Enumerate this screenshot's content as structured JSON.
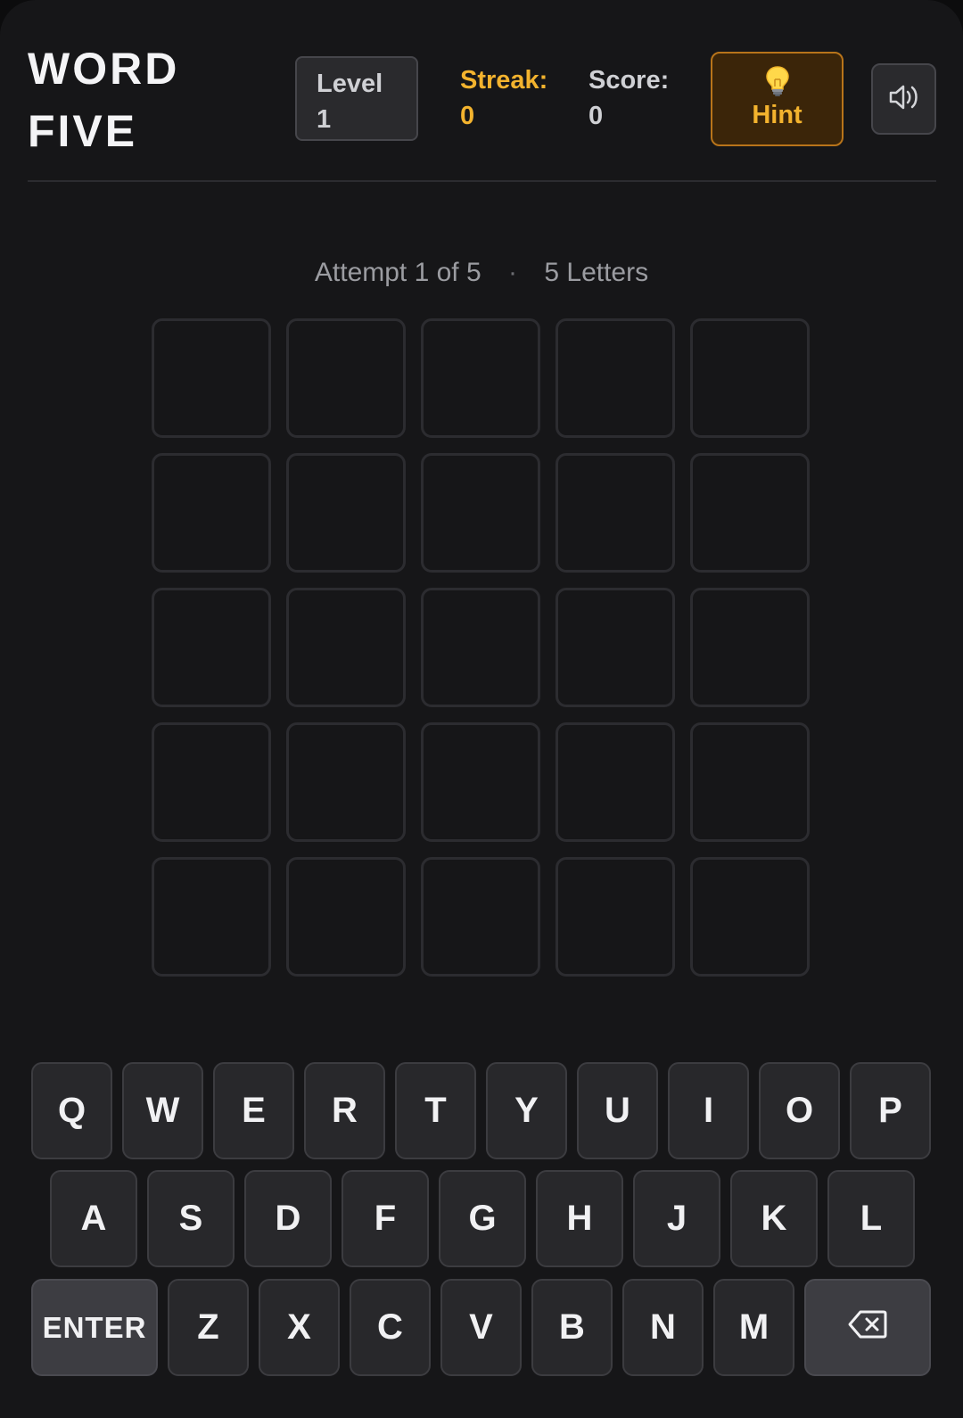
{
  "header": {
    "title_line1": "WORD",
    "title_line2": "FIVE",
    "level_label": "Level",
    "level_value": "1",
    "streak_label": "Streak:",
    "streak_value": "0",
    "score_label": "Score:",
    "score_value": "0",
    "hint_label": "Hint",
    "hint_icon": "lightbulb-icon",
    "sound_icon": "speaker-icon"
  },
  "status": {
    "attempt_text": "Attempt 1 of 5",
    "separator": "·",
    "letters_text": "5 Letters"
  },
  "board": {
    "rows": [
      [
        "",
        "",
        "",
        "",
        ""
      ],
      [
        "",
        "",
        "",
        "",
        ""
      ],
      [
        "",
        "",
        "",
        "",
        ""
      ],
      [
        "",
        "",
        "",
        "",
        ""
      ],
      [
        "",
        "",
        "",
        "",
        ""
      ]
    ]
  },
  "keyboard": {
    "row1": [
      "Q",
      "W",
      "E",
      "R",
      "T",
      "Y",
      "U",
      "I",
      "O",
      "P"
    ],
    "row2": [
      "A",
      "S",
      "D",
      "F",
      "G",
      "H",
      "J",
      "K",
      "L"
    ],
    "row3": [
      "ENTER",
      "Z",
      "X",
      "C",
      "V",
      "B",
      "N",
      "M"
    ],
    "backspace_icon": "backspace-icon"
  },
  "colors": {
    "background": "#161618",
    "accent": "#f3b32e",
    "hint_bg": "#3b2509",
    "tile_border": "#2c2c30",
    "key_bg": "#28282b"
  }
}
